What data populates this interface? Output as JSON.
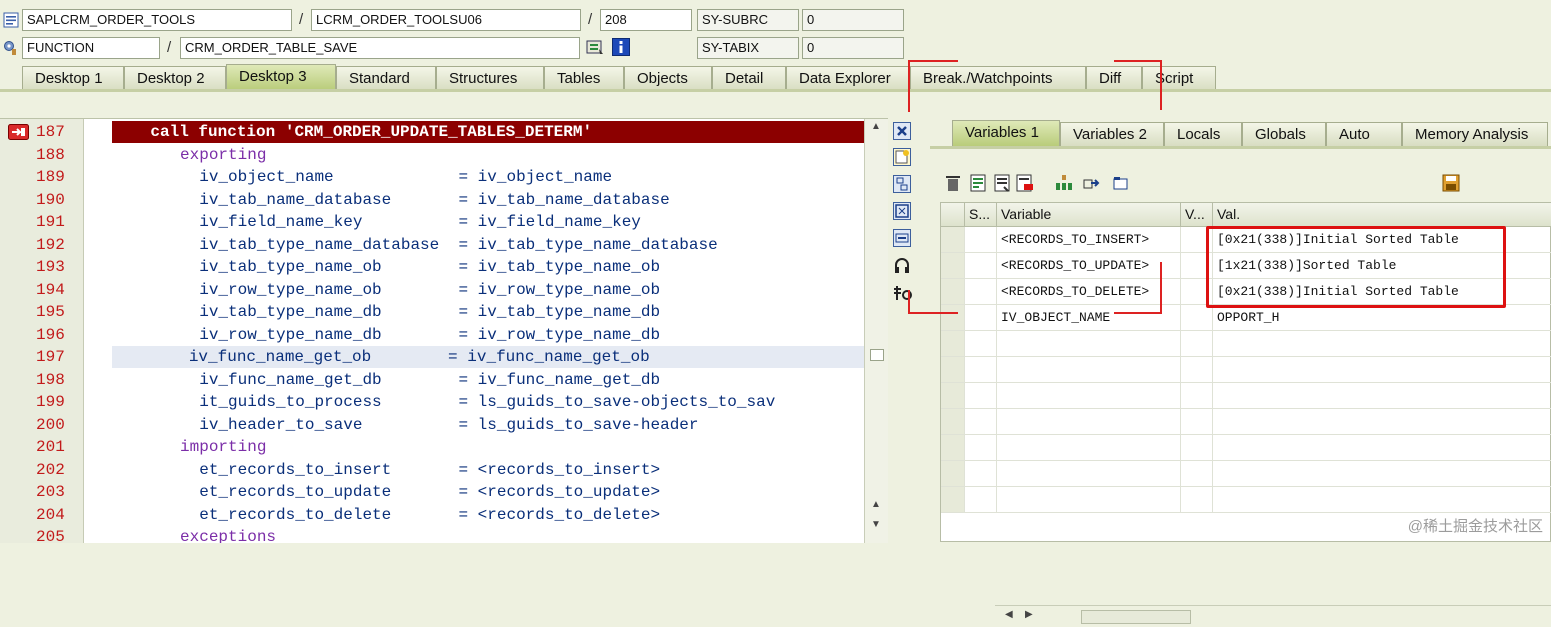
{
  "header": {
    "row1": {
      "program": "SAPLCRM_ORDER_TOOLS",
      "sep1": "/",
      "include": "LCRM_ORDER_TOOLSU06",
      "sep2": "/",
      "line": "208",
      "sysvar": "SY-SUBRC",
      "sysval": "0"
    },
    "row2": {
      "event_type": "FUNCTION",
      "sep1": "/",
      "event": "CRM_ORDER_TABLE_SAVE",
      "sysvar": "SY-TABIX",
      "sysval": "0"
    }
  },
  "tabs": [
    {
      "label": "Desktop 1"
    },
    {
      "label": "Desktop 2"
    },
    {
      "label": "Desktop 3"
    },
    {
      "label": "Standard"
    },
    {
      "label": "Structures"
    },
    {
      "label": "Tables"
    },
    {
      "label": "Objects"
    },
    {
      "label": "Detail"
    },
    {
      "label": "Data Explorer"
    },
    {
      "label": "Break./Watchpoints"
    },
    {
      "label": "Diff"
    },
    {
      "label": "Script"
    }
  ],
  "code": {
    "lines": [
      {
        "num": "187",
        "text": "    call function 'CRM_ORDER_UPDATE_TABLES_DETERM'"
      },
      {
        "num": "188",
        "text": "      exporting"
      },
      {
        "num": "189",
        "text": "        iv_object_name             = iv_object_name"
      },
      {
        "num": "190",
        "text": "        iv_tab_name_database       = iv_tab_name_database"
      },
      {
        "num": "191",
        "text": "        iv_field_name_key          = iv_field_name_key"
      },
      {
        "num": "192",
        "text": "        iv_tab_type_name_database  = iv_tab_type_name_database"
      },
      {
        "num": "193",
        "text": "        iv_tab_type_name_ob        = iv_tab_type_name_ob"
      },
      {
        "num": "194",
        "text": "        iv_row_type_name_ob        = iv_row_type_name_ob"
      },
      {
        "num": "195",
        "text": "        iv_tab_type_name_db        = iv_tab_type_name_db"
      },
      {
        "num": "196",
        "text": "        iv_row_type_name_db        = iv_row_type_name_db"
      },
      {
        "num": "197",
        "text": "        iv_func_name_get_ob        = iv_func_name_get_ob"
      },
      {
        "num": "198",
        "text": "        iv_func_name_get_db        = iv_func_name_get_db"
      },
      {
        "num": "199",
        "text": "        it_guids_to_process        = ls_guids_to_save-objects_to_sav"
      },
      {
        "num": "200",
        "text": "        iv_header_to_save          = ls_guids_to_save-header"
      },
      {
        "num": "201",
        "text": "      importing"
      },
      {
        "num": "202",
        "text": "        et_records_to_insert       = <records_to_insert>"
      },
      {
        "num": "203",
        "text": "        et_records_to_update       = <records_to_update>"
      },
      {
        "num": "204",
        "text": "        et_records_to_delete       = <records_to_delete>"
      },
      {
        "num": "205",
        "text": "      exceptions"
      }
    ]
  },
  "variables_tabs": [
    {
      "label": "Variables 1"
    },
    {
      "label": "Variables 2"
    },
    {
      "label": "Locals"
    },
    {
      "label": "Globals"
    },
    {
      "label": "Auto"
    },
    {
      "label": "Memory Analysis"
    }
  ],
  "grid": {
    "headers": {
      "s": "S...",
      "variable": "Variable",
      "v": "V...",
      "val": "Val."
    },
    "rows": [
      {
        "variable": "<RECORDS_TO_INSERT>",
        "val": "[0x21(338)]Initial Sorted Table"
      },
      {
        "variable": "<RECORDS_TO_UPDATE>",
        "val": "[1x21(338)]Sorted Table"
      },
      {
        "variable": "<RECORDS_TO_DELETE>",
        "val": "[0x21(338)]Initial Sorted Table"
      },
      {
        "variable": "IV_OBJECT_NAME",
        "val": "OPPORT_H"
      }
    ]
  },
  "watermark": "@稀土掘金技术社区",
  "colors": {
    "current_line": "#8c0000",
    "line_number": "#c21a1a",
    "keyword": "#7b2ea8",
    "highlight_box": "#d11111",
    "active_tab": "#c8d98c"
  },
  "icons": {
    "program": "program-icon",
    "function": "function-icon",
    "breakpoint": "breakpoint-icon",
    "info": "info-icon",
    "save": "save-icon"
  }
}
